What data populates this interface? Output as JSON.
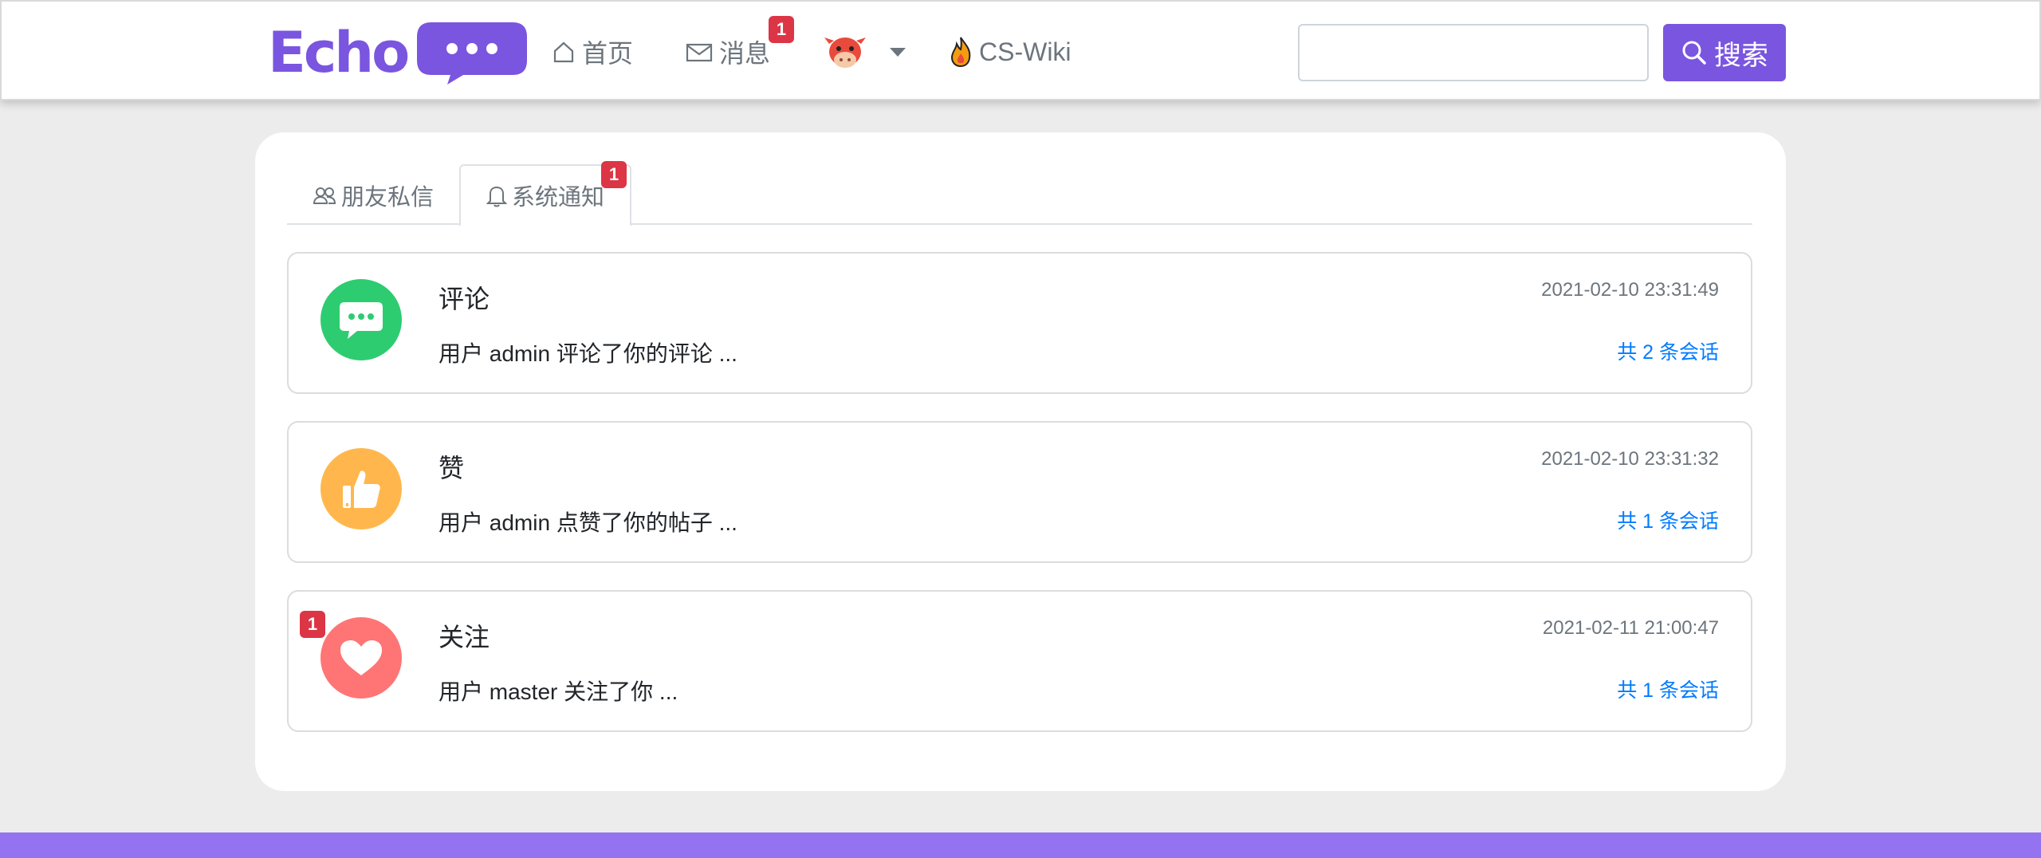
{
  "navbar": {
    "logo_text": "Echo",
    "home_label": "首页",
    "messages_label": "消息",
    "messages_badge": "1",
    "wiki_label": "CS-Wiki",
    "search_placeholder": "",
    "search_button": "搜索",
    "icons": [
      "home-icon",
      "envelope-icon",
      "cow-avatar",
      "fire-icon",
      "search-icon"
    ]
  },
  "tabs": [
    {
      "label": "朋友私信",
      "icon": "people-icon",
      "active": false
    },
    {
      "label": "系统通知",
      "icon": "bell-icon",
      "active": true,
      "badge": "1"
    }
  ],
  "notices": [
    {
      "title": "评论",
      "time": "2021-02-10 23:31:49",
      "desc": "用户 admin 评论了你的评论 ...",
      "count": "共 2 条会话",
      "icon": "comment-icon",
      "color": "#2ecc71",
      "badge": ""
    },
    {
      "title": "赞",
      "time": "2021-02-10 23:31:32",
      "desc": "用户 admin 点赞了你的帖子 ...",
      "count": "共 1 条会话",
      "icon": "thumbs-up-icon",
      "color": "#ffb74d",
      "badge": ""
    },
    {
      "title": "关注",
      "time": "2021-02-11 21:00:47",
      "desc": "用户 master 关注了你 ...",
      "count": "共 1 条会话",
      "icon": "heart-icon",
      "color": "#ff7575",
      "badge": "1"
    }
  ],
  "colors": {
    "brand": "#7a55e0",
    "footer": "#9373f0",
    "badge": "#dc3545",
    "link": "#007bff"
  }
}
